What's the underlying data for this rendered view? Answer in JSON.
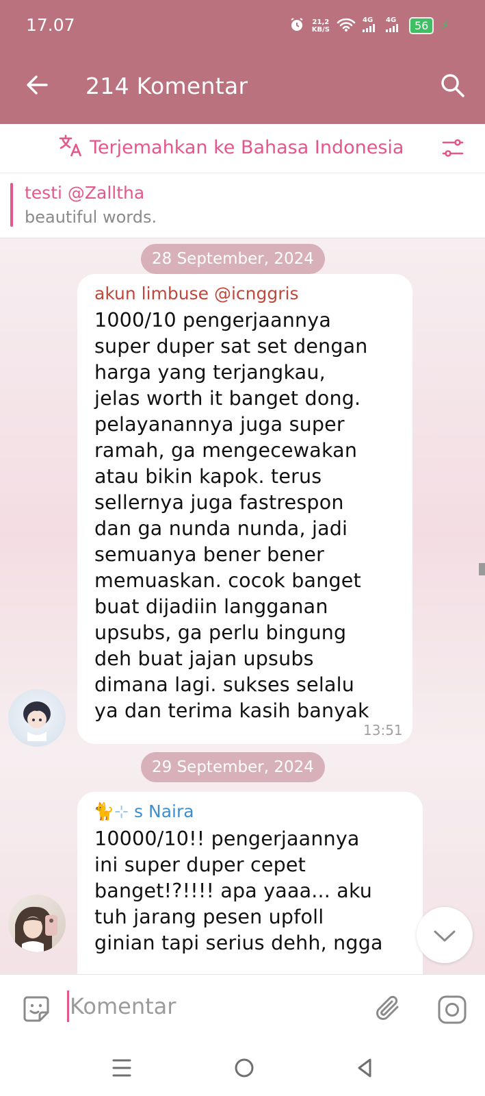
{
  "status_bar": {
    "time": "17.07",
    "net_speed_value": "21,2",
    "net_speed_unit": "KB/S",
    "signal_1": "4G",
    "signal_2": "4G",
    "battery": "56"
  },
  "app_bar": {
    "title": "214 Komentar",
    "back_icon": "arrow-left-icon",
    "search_icon": "search-icon",
    "color": "#b9727e"
  },
  "translate_bar": {
    "label": "Terjemahkan ke Bahasa Indonesia",
    "icon": "translate-icon",
    "settings_icon": "tune-icon",
    "color": "#e5578a"
  },
  "pinned_reply": {
    "author": "testi @Zalltha",
    "text": "beautiful words."
  },
  "messages": [
    {
      "date": "28 September, 2024",
      "author": "akun limbuse @icnggris",
      "author_color": "#c0473c",
      "text": "1000/10 pengerjaannya\nsuper duper sat set dengan\nharga yang terjangkau,\njelas worth it banget dong.\npelayanannya juga super\nramah, ga mengecewakan\natau bikin kapok. terus\nsellernya juga fastrespon\ndan ga nunda nunda, jadi\nsemuanya bener bener\nmemuaskan. cocok banget\nbuat dijadiin langganan\nupsubs, ga perlu bingung\ndeh buat jajan upsubs\ndimana lagi. sukses selalu\nya dan terima kasih banyak",
      "time": "13:51"
    },
    {
      "date": "29 September, 2024",
      "author_emoji": "🐈⊹",
      "author": "s Naira",
      "author_color": "#3d8fd1",
      "text": "10000/10!! pengerjaannya\nini super duper cepet\nbanget!?!!!! apa yaaa... aku\ntuh jarang pesen upfoll\nginian tapi serius dehh, ngga"
    }
  ],
  "composer": {
    "placeholder": "Komentar",
    "emoji_icon": "sticker-icon",
    "attach_icon": "paperclip-icon",
    "camera_icon": "instagram-camera-icon"
  },
  "nav_bar": {
    "menu_icon": "menu-lines-icon",
    "home_icon": "circle-home-icon",
    "back_icon": "triangle-back-icon"
  }
}
